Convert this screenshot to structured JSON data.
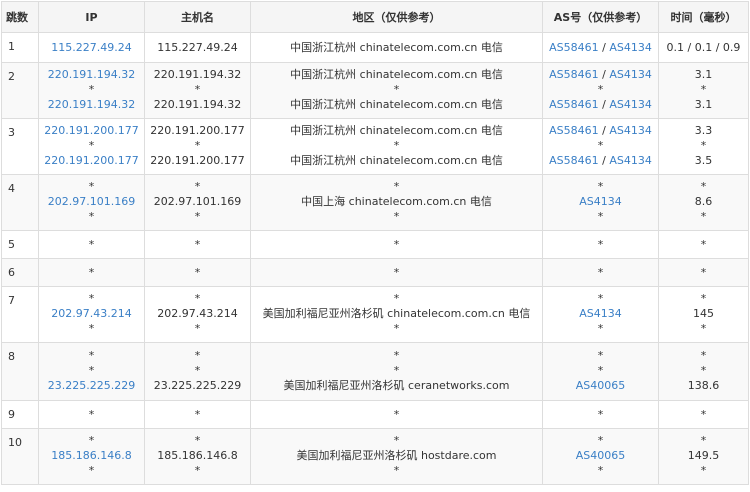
{
  "headers": {
    "hop": "跳数",
    "ip": "IP",
    "host": "主机名",
    "geo": "地区（仅供参考）",
    "as": "AS号（仅供参考）",
    "time": "时间（毫秒）"
  },
  "rows": [
    {
      "hop": "1",
      "height": 30,
      "ip": [
        "115.227.49.24"
      ],
      "host": [
        "115.227.49.24"
      ],
      "geo": [
        "中国浙江杭州 chinatelecom.com.cn 电信"
      ],
      "as": [
        [
          "AS58461",
          "AS4134"
        ]
      ],
      "time": [
        "0.1 / 0.1 / 0.9"
      ]
    },
    {
      "hop": "2",
      "height": 56,
      "ip": [
        "220.191.194.32",
        "*",
        "220.191.194.32"
      ],
      "host": [
        "220.191.194.32",
        "*",
        "220.191.194.32"
      ],
      "geo": [
        "中国浙江杭州 chinatelecom.com.cn 电信",
        "*",
        "中国浙江杭州 chinatelecom.com.cn 电信"
      ],
      "as": [
        [
          "AS58461",
          "AS4134"
        ],
        [
          "*"
        ],
        [
          "AS58461",
          "AS4134"
        ]
      ],
      "time": [
        "3.1",
        "*",
        "3.1"
      ]
    },
    {
      "hop": "3",
      "height": 56,
      "ip": [
        "220.191.200.177",
        "*",
        "220.191.200.177"
      ],
      "host": [
        "220.191.200.177",
        "*",
        "220.191.200.177"
      ],
      "geo": [
        "中国浙江杭州 chinatelecom.com.cn 电信",
        "*",
        "中国浙江杭州 chinatelecom.com.cn 电信"
      ],
      "as": [
        [
          "AS58461",
          "AS4134"
        ],
        [
          "*"
        ],
        [
          "AS58461",
          "AS4134"
        ]
      ],
      "time": [
        "3.3",
        "*",
        "3.5"
      ]
    },
    {
      "hop": "4",
      "height": 56,
      "ip": [
        "*",
        "202.97.101.169",
        "*"
      ],
      "host": [
        "*",
        "202.97.101.169",
        "*"
      ],
      "geo": [
        "*",
        "中国上海 chinatelecom.com.cn 电信",
        "*"
      ],
      "as": [
        [
          "*"
        ],
        [
          "AS4134"
        ],
        [
          "*"
        ]
      ],
      "time": [
        "*",
        "8.6",
        "*"
      ]
    },
    {
      "hop": "5",
      "height": 28,
      "ip": [
        "*"
      ],
      "host": [
        "*"
      ],
      "geo": [
        "*"
      ],
      "as": [
        [
          "*"
        ]
      ],
      "time": [
        "*"
      ]
    },
    {
      "hop": "6",
      "height": 28,
      "ip": [
        "*"
      ],
      "host": [
        "*"
      ],
      "geo": [
        "*"
      ],
      "as": [
        [
          "*"
        ]
      ],
      "time": [
        "*"
      ]
    },
    {
      "hop": "7",
      "height": 56,
      "ip": [
        "*",
        "202.97.43.214",
        "*"
      ],
      "host": [
        "*",
        "202.97.43.214",
        "*"
      ],
      "geo": [
        "*",
        "美国加利福尼亚州洛杉矶 chinatelecom.com.cn 电信",
        "*"
      ],
      "as": [
        [
          "*"
        ],
        [
          "AS4134"
        ],
        [
          "*"
        ]
      ],
      "time": [
        "*",
        "145",
        "*"
      ]
    },
    {
      "hop": "8",
      "height": 58,
      "ip": [
        "*",
        "*",
        "23.225.225.229"
      ],
      "host": [
        "*",
        "*",
        "23.225.225.229"
      ],
      "geo": [
        "*",
        "*",
        "美国加利福尼亚州洛杉矶 ceranetworks.com"
      ],
      "as": [
        [
          "*"
        ],
        [
          "*"
        ],
        [
          "AS40065"
        ]
      ],
      "time": [
        "*",
        "*",
        "138.6"
      ]
    },
    {
      "hop": "9",
      "height": 28,
      "ip": [
        "*"
      ],
      "host": [
        "*"
      ],
      "geo": [
        "*"
      ],
      "as": [
        [
          "*"
        ]
      ],
      "time": [
        "*"
      ]
    },
    {
      "hop": "10",
      "height": 56,
      "ip": [
        "*",
        "185.186.146.8",
        "*"
      ],
      "host": [
        "*",
        "185.186.146.8",
        "*"
      ],
      "geo": [
        "*",
        "美国加利福尼亚州洛杉矶 hostdare.com",
        "*"
      ],
      "as": [
        [
          "*"
        ],
        [
          "AS40065"
        ],
        [
          "*"
        ]
      ],
      "time": [
        "*",
        "149.5",
        "*"
      ]
    }
  ],
  "colors": {
    "link": "#3a7fc6",
    "text": "#333333",
    "border": "#dddddd",
    "header_bg": "#f5f5f5",
    "stripe_bg": "#f9f9f9"
  }
}
